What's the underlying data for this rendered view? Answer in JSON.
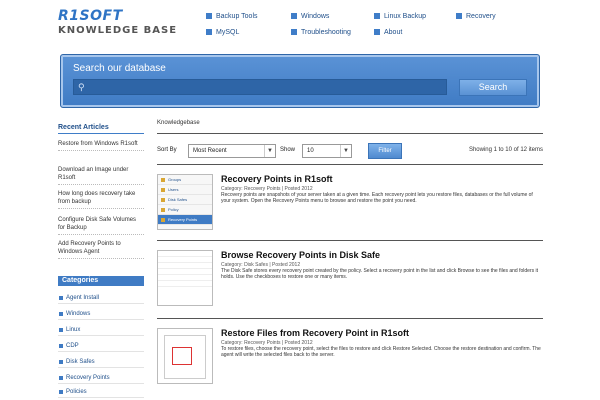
{
  "header": {
    "logo_top": "R1SOFT",
    "logo_bottom": "KNOWLEDGE BASE",
    "nav": [
      {
        "label": "Backup Tools"
      },
      {
        "label": "Windows"
      },
      {
        "label": "Linux Backup"
      },
      {
        "label": "Recovery"
      },
      {
        "label": "MySQL"
      },
      {
        "label": "Troubleshooting"
      },
      {
        "label": "About"
      }
    ]
  },
  "search": {
    "title": "Search our database",
    "placeholder": "",
    "button_label": "Search"
  },
  "sidebar": {
    "recent_heading": "Recent Articles",
    "recent_links": [
      "Restore from Windows R1soft",
      "Download an Image under R1soft",
      "How long does recovery take from backup",
      "Configure Disk Safe Volumes for Backup",
      "Add Recovery Points to Windows Agent"
    ],
    "categories_heading": "Categories",
    "categories": [
      "Agent Install",
      "Windows",
      "Linux",
      "CDP",
      "Disk Safes",
      "Recovery Points",
      "Policies"
    ]
  },
  "main": {
    "breadcrumb": "Knowledgebase",
    "sort_label": "Sort By",
    "sort_value": "Most Recent",
    "show_label": "Show",
    "show_value": "10",
    "filter_label": "Filter",
    "results_info": "Showing 1 to 10 of 12 items",
    "articles": [
      {
        "title": "Recovery Points in R1soft",
        "meta": "Category: Recovery Points | Posted 2012",
        "text": "Recovery points are snapshots of your server taken at a given time. Each recovery point lets you restore files, databases or the full volume of your system. Open the Recovery Points menu to browse and restore the point you need."
      },
      {
        "title": "Browse Recovery Points in Disk Safe",
        "meta": "Category: Disk Safes | Posted 2012",
        "text": "The Disk Safe stores every recovery point created by the policy. Select a recovery point in the list and click Browse to see the files and folders it holds. Use the checkboxes to restore one or many items."
      },
      {
        "title": "Restore Files from Recovery Point in R1soft",
        "meta": "Category: Recovery Points | Posted 2012",
        "text": "To restore files, choose the recovery point, select the files to restore and click Restore Selected. Choose the restore destination and confirm. The agent will write the selected files back to the server."
      }
    ],
    "thumb_menu": [
      "Groups",
      "Users",
      "Disk Safes",
      "Policy",
      "Recovery Points"
    ]
  },
  "colors": {
    "accent": "#3f7bc4",
    "search_bg": "#4f8acf"
  }
}
